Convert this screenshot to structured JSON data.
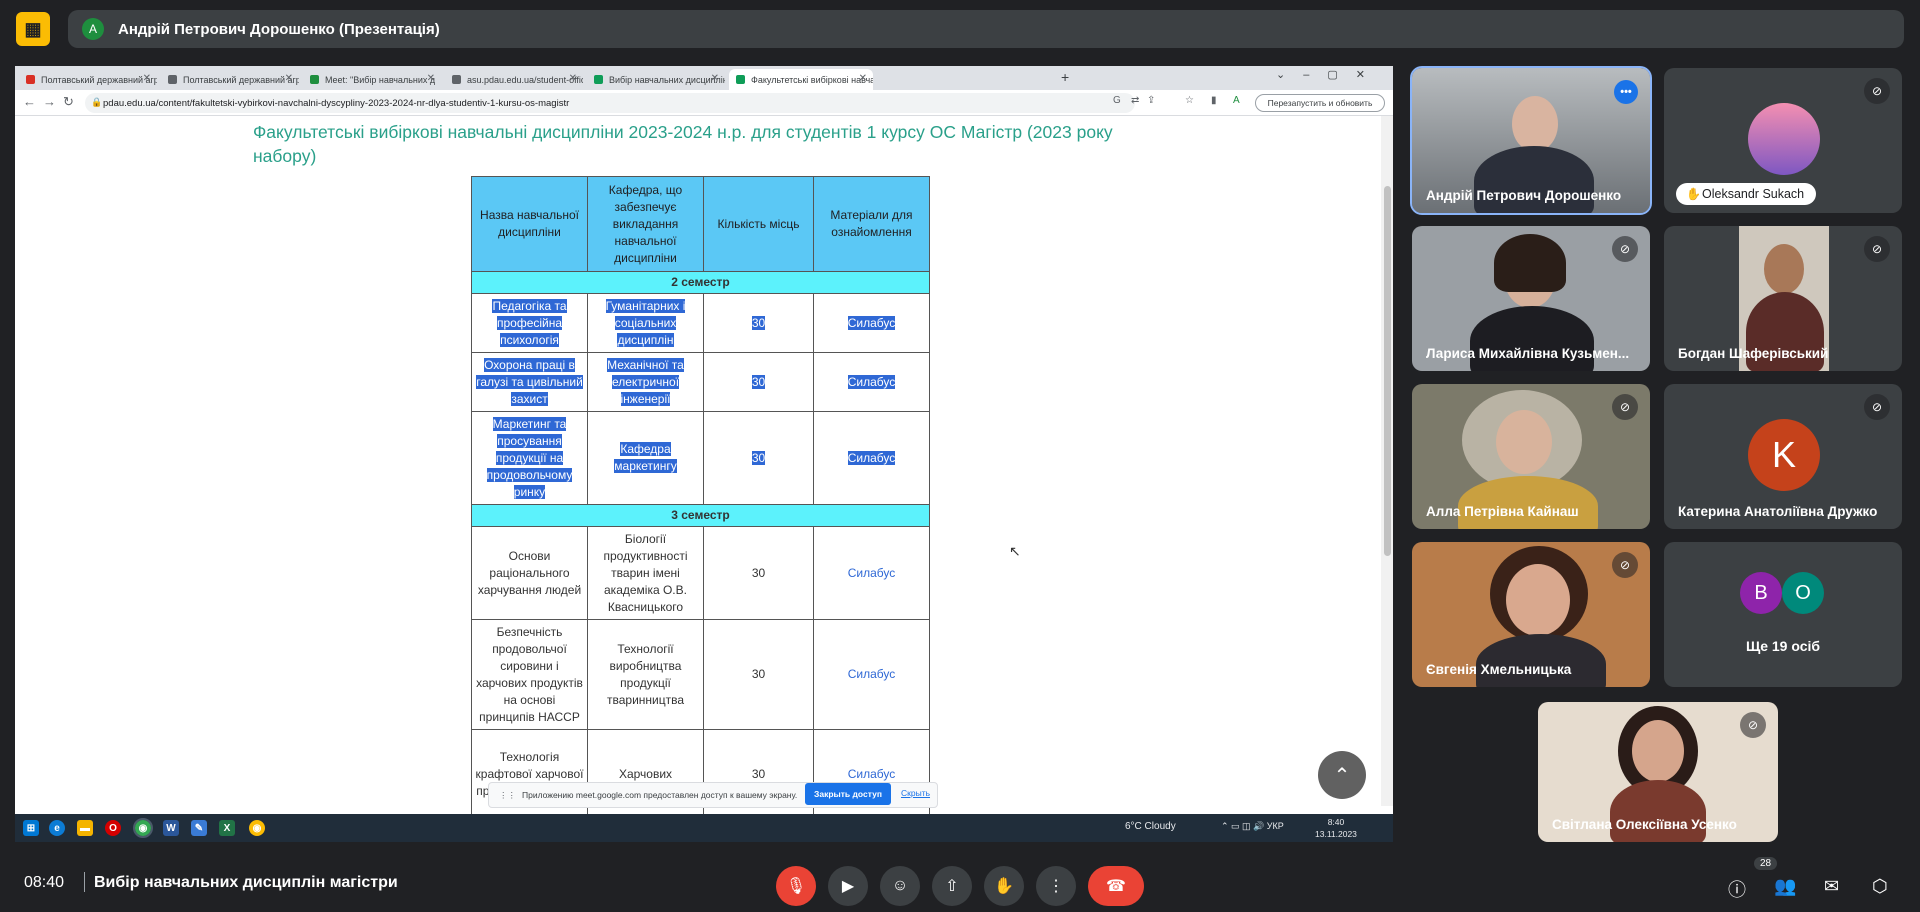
{
  "meeting": {
    "presenter_initial": "А",
    "presenter_label": "Андрій Петрович Дорошенко (Презентація)",
    "time": "08:40",
    "title": "Вибір навчальних дисциплін магістри",
    "people_count": "28"
  },
  "browser": {
    "tabs": [
      {
        "label": "Полтавський державний аграр",
        "color": "#d93025"
      },
      {
        "label": "Полтавський державний аграр",
        "color": "#5f6368"
      },
      {
        "label": "Meet: \"Вибір навчальних д",
        "color": "#1e8e3e"
      },
      {
        "label": "asu.pdau.edu.ua/student-officr",
        "color": "#5f6368"
      },
      {
        "label": "Вибір навчальних дисциплін |",
        "color": "#0f9d58"
      },
      {
        "label": "Факультетські вибіркові навча",
        "color": "#0f9d58"
      }
    ],
    "url": "pdau.edu.ua/content/fakultetski-vybirkovi-navchalni-dyscypliny-2023-2024-nr-dlya-studentiv-1-kursu-os-magistr",
    "restart_label": "Перезапустить и обновить",
    "profile_initial": "A"
  },
  "page": {
    "heading": "Факультетські вибіркові навчальні дисципліни 2023-2024 н.р. для студентів 1 курсу ОС Магістр (2023 року набору)",
    "table": {
      "headers": [
        "Назва навчальної дисципліни",
        "Кафедра, що забезпечує викладання навчальної дисципліни",
        "Кількість місць",
        "Матеріали для ознайомлення"
      ],
      "semester2": "2 семестр",
      "semester3": "3 семестр",
      "rows_sem2": [
        {
          "name": "Педагогіка та професійна психологія",
          "dept": "Гуманітарних і соціальних дисциплін",
          "seats": "30",
          "link": "Силабус"
        },
        {
          "name": "Охорона праці в галузі та цивільний захист",
          "dept": "Механічної та електричної інженерії",
          "seats": "30",
          "link": "Силабус"
        },
        {
          "name": "Маркетинг та просування продукції на продовольчому ринку",
          "dept": "Кафедра маркетингу",
          "seats": "30",
          "link": "Силабус"
        }
      ],
      "rows_sem3": [
        {
          "name": "Основи раціонального харчування людей",
          "dept": "Біології продуктивності тварин імені академіка О.В. Квасницького",
          "seats": "30",
          "link": "Силабус"
        },
        {
          "name": "Безпечність продовольчої сировини і харчових продуктів на основі принципів НАССР",
          "dept": "Технології виробництва продукції тваринництва",
          "seats": "30",
          "link": "Силабус"
        },
        {
          "name": "Технологія крафтової харчової продукції сировини",
          "dept": "Харчових",
          "seats": "30",
          "link": "Силабус"
        }
      ]
    },
    "share_notice": "Приложению meet.google.com предоставлен доступ к вашему экрану.",
    "share_stop": "Закрыть доступ",
    "share_hide": "Скрыть"
  },
  "taskbar": {
    "weather": "6°C  Cloudy",
    "lang": "УКР",
    "clock_time": "8:40",
    "clock_date": "13.11.2023"
  },
  "participants": [
    {
      "name": "Андрій Петрович Дорошенко"
    },
    {
      "name": "Oleksandr Sukach"
    },
    {
      "name": "Лариса Михайлівна Кузьмен..."
    },
    {
      "name": "Богдан Шаферівський"
    },
    {
      "name": "Алла Петрівна Кайнаш"
    },
    {
      "name": "Катерина Анатоліївна Дружко",
      "initial": "K"
    },
    {
      "name": "Євгенія Хмельницька"
    },
    {
      "name": "Ще 19 осіб",
      "initials": [
        "B",
        "O"
      ]
    },
    {
      "name": "Світлана Олексіївна Усенко"
    }
  ],
  "colors": {
    "accent_teal": "#2aa08a",
    "header_blue": "#5bc8f5",
    "semester_cyan": "#5cf2fc",
    "selection": "#2f68d5",
    "leave_red": "#ea4335"
  }
}
